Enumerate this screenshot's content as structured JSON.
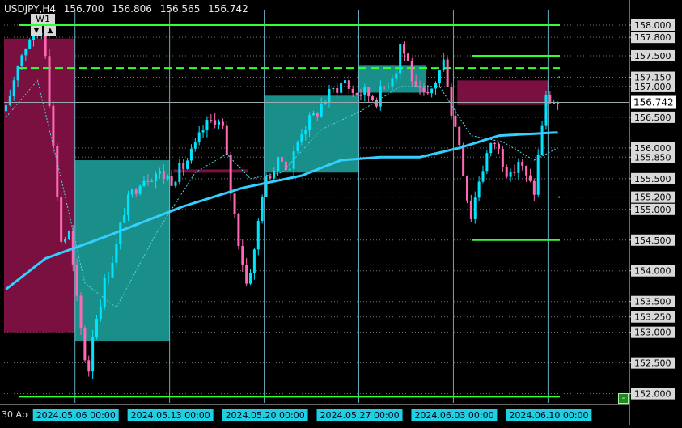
{
  "header": {
    "symbol": "USDJPY,H4",
    "open": "156.700",
    "high": "156.806",
    "low": "156.565",
    "close": "156.742"
  },
  "timeframe_label": "W1",
  "buttons": {
    "down": "▼",
    "up": "▲",
    "corner": "-"
  },
  "colors": {
    "background": "#000000",
    "bull": "#00e5ff",
    "bear": "#ff69b4",
    "ma_fast": "#4fd6e8",
    "ma_slow": "#33d0ff",
    "level": "#33ff33",
    "zone_bear": "#7a1040",
    "zone_bull": "#1a8f8a",
    "price_tag": "#ffffff",
    "grid": "#777777"
  },
  "chart_data": {
    "type": "candlestick",
    "symbol": "USDJPY",
    "timeframe": "H4",
    "ylim": [
      151.85,
      158.25
    ],
    "y_ticks": [
      "158.000",
      "157.800",
      "157.500",
      "157.150",
      "157.000",
      "156.500",
      "156.000",
      "155.850",
      "155.500",
      "155.200",
      "155.000",
      "154.500",
      "154.000",
      "153.500",
      "153.250",
      "153.000",
      "152.500",
      "152.000"
    ],
    "current_price": "156.742",
    "x_labels": [
      "30 Ap",
      "2024.05.06 00:00",
      "2024.05.13 00:00",
      "2024.05.20 00:00",
      "2024.05.27 00:00",
      "2024.06.03 00:00",
      "2024.06.10 00:00"
    ],
    "bar_count": 146,
    "key_points": [
      [
        0,
        156.6
      ],
      [
        3,
        157.4
      ],
      [
        6,
        157.8
      ],
      [
        9,
        157.9
      ],
      [
        10,
        157.6
      ],
      [
        12,
        156.0
      ],
      [
        14,
        154.5
      ],
      [
        16,
        154.6
      ],
      [
        18,
        153.5
      ],
      [
        20,
        152.6
      ],
      [
        21,
        152.4
      ],
      [
        22,
        153.0
      ],
      [
        25,
        153.8
      ],
      [
        28,
        154.4
      ],
      [
        30,
        155.0
      ],
      [
        34,
        155.5
      ],
      [
        38,
        155.6
      ],
      [
        42,
        155.5
      ],
      [
        45,
        155.7
      ],
      [
        48,
        156.0
      ],
      [
        50,
        156.3
      ],
      [
        53,
        156.5
      ],
      [
        55,
        156.3
      ],
      [
        57,
        155.3
      ],
      [
        59,
        154.5
      ],
      [
        61,
        153.8
      ],
      [
        63,
        154.3
      ],
      [
        65,
        155.3
      ],
      [
        67,
        155.6
      ],
      [
        70,
        155.8
      ],
      [
        72,
        155.7
      ],
      [
        75,
        156.3
      ],
      [
        78,
        156.5
      ],
      [
        81,
        156.8
      ],
      [
        84,
        157.0
      ],
      [
        86,
        157.1
      ],
      [
        88,
        156.9
      ],
      [
        91,
        156.9
      ],
      [
        94,
        156.8
      ],
      [
        97,
        157.1
      ],
      [
        99,
        157.3
      ],
      [
        100,
        157.7
      ],
      [
        102,
        157.4
      ],
      [
        104,
        156.9
      ],
      [
        107,
        156.8
      ],
      [
        109,
        157.1
      ],
      [
        111,
        157.4
      ],
      [
        112,
        157.1
      ],
      [
        113,
        156.6
      ],
      [
        115,
        156.1
      ],
      [
        117,
        155.2
      ],
      [
        118,
        154.9
      ],
      [
        120,
        155.5
      ],
      [
        122,
        155.9
      ],
      [
        124,
        156.1
      ],
      [
        126,
        155.8
      ],
      [
        128,
        155.5
      ],
      [
        130,
        155.8
      ],
      [
        132,
        155.5
      ],
      [
        134,
        155.3
      ],
      [
        136,
        156.4
      ],
      [
        137,
        156.8
      ],
      [
        140,
        156.74
      ]
    ],
    "moving_average_slow": [
      [
        0,
        153.7
      ],
      [
        10,
        154.2
      ],
      [
        25,
        154.55
      ],
      [
        45,
        155.05
      ],
      [
        60,
        155.35
      ],
      [
        75,
        155.55
      ],
      [
        85,
        155.8
      ],
      [
        95,
        155.85
      ],
      [
        105,
        155.85
      ],
      [
        115,
        156.0
      ],
      [
        125,
        156.2
      ],
      [
        139,
        156.25
      ]
    ],
    "moving_average_fast": [
      [
        0,
        156.5
      ],
      [
        8,
        157.1
      ],
      [
        14,
        155.5
      ],
      [
        20,
        153.8
      ],
      [
        28,
        153.4
      ],
      [
        38,
        154.6
      ],
      [
        48,
        155.6
      ],
      [
        56,
        155.9
      ],
      [
        62,
        155.5
      ],
      [
        70,
        155.6
      ],
      [
        80,
        156.3
      ],
      [
        90,
        156.6
      ],
      [
        100,
        157.0
      ],
      [
        110,
        157.0
      ],
      [
        118,
        156.2
      ],
      [
        126,
        156.1
      ],
      [
        134,
        155.8
      ],
      [
        140,
        156.0
      ]
    ],
    "levels": [
      {
        "price": 158.0,
        "style": "solid",
        "from_bar": 0,
        "to_bar": 140
      },
      {
        "price": 157.3,
        "style": "dashed",
        "from_bar": 0,
        "to_bar": 140
      },
      {
        "price": 157.5,
        "style": "solid",
        "from_bar": 115,
        "to_bar": 140
      },
      {
        "price": 154.5,
        "style": "solid",
        "from_bar": 115,
        "to_bar": 140
      },
      {
        "price": 151.95,
        "style": "solid",
        "from_bar": 0,
        "to_bar": 140
      },
      {
        "price": 157.15,
        "style": "solid",
        "from_bar": 137,
        "to_bar": 140
      },
      {
        "price": 155.2,
        "style": "solid",
        "from_bar": 137,
        "to_bar": 140
      }
    ],
    "zones": [
      {
        "kind": "bear",
        "from_bar": 0,
        "to_bar": 17,
        "high": 157.78,
        "low": 153.0
      },
      {
        "kind": "bull",
        "from_bar": 18,
        "to_bar": 41,
        "high": 155.8,
        "low": 152.85
      },
      {
        "kind": "bear",
        "from_bar": 43,
        "to_bar": 61,
        "high": 155.65,
        "low": 155.6
      },
      {
        "kind": "bull",
        "from_bar": 66,
        "to_bar": 89,
        "high": 156.85,
        "low": 155.6
      },
      {
        "kind": "bull",
        "from_bar": 90,
        "to_bar": 106,
        "high": 157.35,
        "low": 156.9
      },
      {
        "kind": "bear",
        "from_bar": 115,
        "to_bar": 137,
        "high": 157.1,
        "low": 156.7
      }
    ],
    "vertical_lines_at_bars": [
      18,
      42,
      66,
      90,
      114,
      138
    ]
  }
}
